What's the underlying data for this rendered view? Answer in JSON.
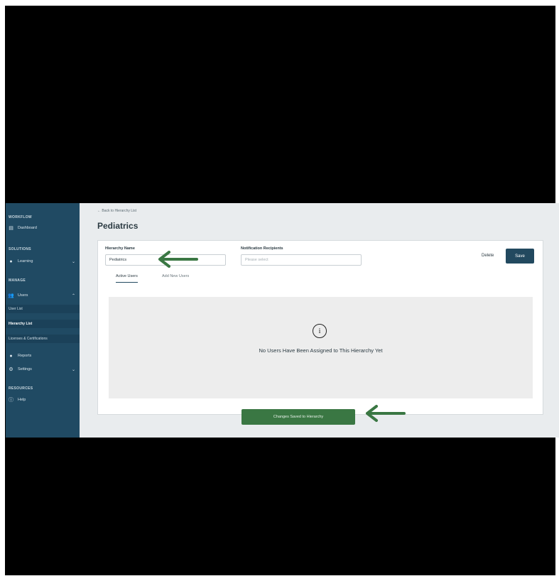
{
  "sidebar": {
    "sections": [
      {
        "label": "WORKFLOW"
      },
      {
        "label": "SOLUTIONS"
      },
      {
        "label": "MANAGE"
      },
      {
        "label": "RESOURCES"
      }
    ],
    "items": [
      {
        "label": "Dashboard",
        "icon": "dashboard-icon"
      },
      {
        "label": "Learning",
        "icon": "lightbulb-icon"
      },
      {
        "label": "Users",
        "icon": "users-icon"
      },
      {
        "label": "Reports",
        "icon": "reports-icon"
      },
      {
        "label": "Settings",
        "icon": "gear-icon"
      },
      {
        "label": "Help",
        "icon": "help-icon"
      }
    ],
    "subitems": [
      {
        "label": "User List"
      },
      {
        "label": "Hierarchy List"
      },
      {
        "label": "Licenses & Certifications"
      }
    ]
  },
  "main": {
    "back_link": "Back to Hierarchy List",
    "title": "Pediatrics",
    "hierarchy_name_label": "Hierarchy Name",
    "hierarchy_name_value": "Pediatrics",
    "notification_label": "Notification Recipients",
    "notification_placeholder": "Please select",
    "delete_label": "Delete",
    "save_label": "Save",
    "tabs": [
      {
        "label": "Active Users"
      },
      {
        "label": "Add New Users"
      }
    ],
    "empty_icon_glyph": "i",
    "empty_message": "No Users Have Been Assigned to This Hierarchy Yet",
    "change_button_label": "Changes Saved to Hierarchy"
  },
  "colors": {
    "sidebar_bg": "#204a63",
    "primary_button": "#22495f",
    "success_button": "#3a7743",
    "annotation_arrow": "#3a7743"
  }
}
